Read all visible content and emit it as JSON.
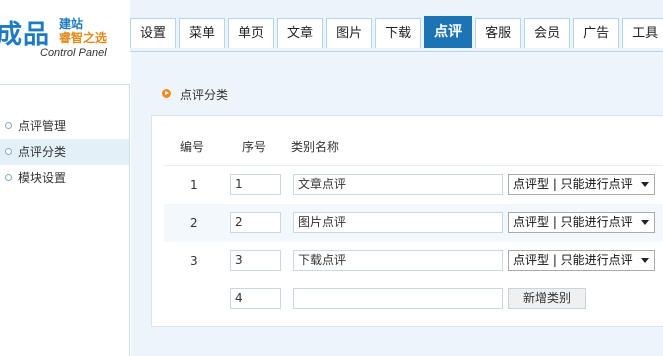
{
  "logo": {
    "main_text": "成品",
    "line1": "建站",
    "line2": "睿智之选",
    "subtitle": "Control Panel"
  },
  "nav": {
    "tabs": [
      {
        "label": "设置"
      },
      {
        "label": "菜单"
      },
      {
        "label": "单页"
      },
      {
        "label": "文章"
      },
      {
        "label": "图片"
      },
      {
        "label": "下载"
      },
      {
        "label": "点评",
        "active": true
      },
      {
        "label": "客服"
      },
      {
        "label": "会员"
      },
      {
        "label": "广告"
      },
      {
        "label": "工具"
      }
    ]
  },
  "sidebar": {
    "items": [
      {
        "label": "点评管理"
      },
      {
        "label": "点评分类",
        "active": true
      },
      {
        "label": "模块设置"
      }
    ]
  },
  "breadcrumb": {
    "label": "点评分类"
  },
  "table": {
    "headers": {
      "id": "编号",
      "order": "序号",
      "name": "类别名称"
    },
    "rows": [
      {
        "id": "1",
        "order": "1",
        "name": "文章点评",
        "type": "点评型 | 只能进行点评"
      },
      {
        "id": "2",
        "order": "2",
        "name": "图片点评",
        "type": "点评型 | 只能进行点评"
      },
      {
        "id": "3",
        "order": "3",
        "name": "下载点评",
        "type": "点评型 | 只能进行点评"
      }
    ],
    "new_row": {
      "order": "4",
      "name": "",
      "add_button": "新增类别"
    }
  },
  "colors": {
    "accent": "#1d74b5",
    "header_bg": "#eaf4fa",
    "main_bg": "#eef5fa",
    "crumb_icon": "#ee8a1e"
  }
}
